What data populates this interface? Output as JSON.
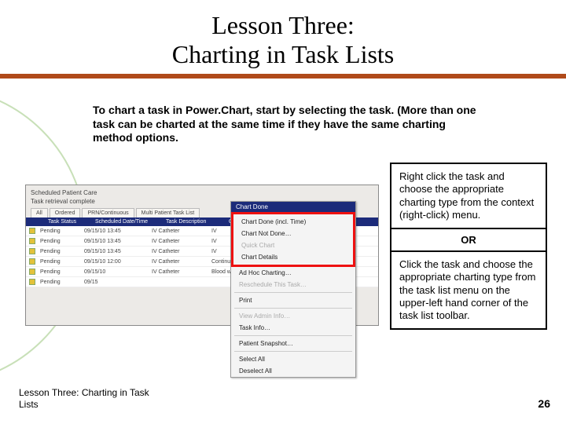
{
  "header": {
    "title_line1": "Lesson Three:",
    "title_line2": "Charting in Task Lists"
  },
  "intro": "To chart a task in Power.Chart, start by selecting the task. (More than one task can be charted at the same time if they have the same charting method options.",
  "screenshot": {
    "window_title": "Scheduled Patient Care",
    "subtitle": "Task retrieval complete",
    "tabs": [
      "All",
      "Ordered",
      "PRN/Continuous",
      "Multi Patient Task List"
    ],
    "columns": [
      "",
      "Task Status",
      "Scheduled Date/Time",
      "Task Description",
      "Order"
    ],
    "rows": [
      {
        "status": "Pending",
        "dt": "09/15/10 13:45",
        "desc": "IV Catheter",
        "order": "IV"
      },
      {
        "status": "Pending",
        "dt": "09/15/10 13:45",
        "desc": "IV Catheter",
        "order": "IV"
      },
      {
        "status": "Pending",
        "dt": "09/15/10 13:45",
        "desc": "IV Catheter",
        "order": "IV"
      },
      {
        "status": "Pending",
        "dt": "09/15/10 12:00",
        "desc": "IV Catheter",
        "order": "Continuous"
      },
      {
        "status": "Pending",
        "dt": "09/15/10",
        "desc": "IV Catheter",
        "order": "Blood warmer"
      },
      {
        "status": "Pending",
        "dt": "09/15",
        "desc": "",
        "order": ""
      }
    ],
    "context_menu": {
      "title": "Chart Done",
      "items": [
        {
          "label": "Chart Done (incl. Time)",
          "disabled": false
        },
        {
          "label": "Chart Not Done…",
          "disabled": false
        },
        {
          "label": "Quick Chart",
          "disabled": true
        },
        {
          "label": "Chart Details",
          "disabled": false
        },
        {
          "label": "Ad Hoc Charting…",
          "disabled": false
        },
        {
          "label": "Reschedule This Task…",
          "disabled": true
        },
        {
          "label": "Print",
          "disabled": false
        },
        {
          "label": "View Admin Info…",
          "disabled": true
        },
        {
          "label": "Task Info…",
          "disabled": false
        },
        {
          "label": "Patient Snapshot…",
          "disabled": false
        },
        {
          "label": "Select All",
          "disabled": false
        },
        {
          "label": "Deselect All",
          "disabled": false
        }
      ]
    }
  },
  "callouts": {
    "first": "Right click the task and choose the appropriate charting type from the context (right-click) menu.",
    "or": "OR",
    "second": "Click the task and choose the appropriate charting type from the task list menu on the upper-left hand corner of the task list toolbar."
  },
  "footer": {
    "left": "Lesson Three: Charting in Task Lists",
    "page": "26"
  }
}
